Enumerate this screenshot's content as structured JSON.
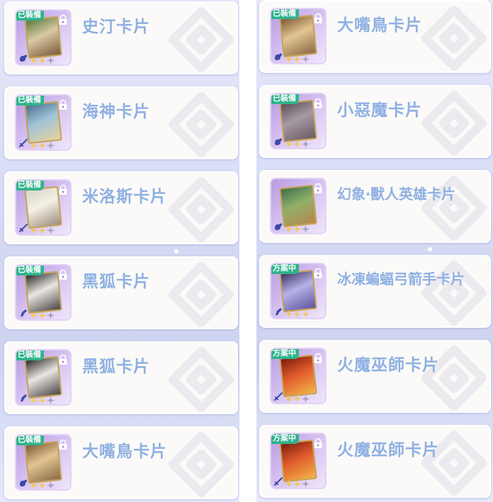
{
  "columns": [
    {
      "cards": [
        {
          "badge": "已裝備",
          "name": "史汀卡片",
          "stars_filled": 2,
          "stars_total": 3,
          "art": "c1",
          "type_icon": "dragon-icon"
        },
        {
          "badge": "已裝備",
          "name": "海神卡片",
          "stars_filled": 2,
          "stars_total": 3,
          "art": "c2",
          "type_icon": "sword-icon"
        },
        {
          "badge": "已裝備",
          "name": "米洛斯卡片",
          "stars_filled": 2,
          "stars_total": 3,
          "art": "c3",
          "type_icon": "sword-icon"
        },
        {
          "badge": "已裝備",
          "name": "黑狐卡片",
          "stars_filled": 2,
          "stars_total": 3,
          "art": "c4",
          "type_icon": "gun-icon"
        },
        {
          "badge": "已裝備",
          "name": "黑狐卡片",
          "stars_filled": 2,
          "stars_total": 3,
          "art": "c4",
          "type_icon": "gun-icon"
        },
        {
          "badge": "已裝備",
          "name": "大嘴鳥卡片",
          "stars_filled": 2,
          "stars_total": 3,
          "art": "c5",
          "type_icon": "dragon-icon"
        }
      ]
    },
    {
      "cards": [
        {
          "badge": "已裝備",
          "name": "大嘴鳥卡片",
          "stars_filled": 2,
          "stars_total": 3,
          "art": "c5",
          "type_icon": "dragon-icon"
        },
        {
          "badge": "已裝備",
          "name": "小惡魔卡片",
          "stars_filled": 2,
          "stars_total": 3,
          "art": "c6",
          "type_icon": "dragon-icon"
        },
        {
          "badge": "",
          "name": "幻象‧獸人英雄卡片",
          "stars_filled": 2,
          "stars_total": 3,
          "art": "c7",
          "type_icon": "dragon-icon"
        },
        {
          "badge": "方案中",
          "name": "冰凍蝙蝠弓箭手卡片",
          "stars_filled": 3,
          "stars_total": 3,
          "art": "c8",
          "type_icon": "gun-icon"
        },
        {
          "badge": "方案中",
          "name": "火魔巫師卡片",
          "stars_filled": 2,
          "stars_total": 3,
          "art": "c9",
          "type_icon": "sword-icon"
        },
        {
          "badge": "方案中",
          "name": "火魔巫師卡片",
          "stars_filled": 2,
          "stars_total": 3,
          "art": "c9",
          "type_icon": "sword-icon"
        }
      ]
    }
  ],
  "colors": {
    "badge_green": "#2fb38c",
    "name_text": "#8fb0e3",
    "star_gold": "#f0c85a",
    "star_gray": "#a79fb8",
    "thumb_purple": "#b89be0"
  }
}
